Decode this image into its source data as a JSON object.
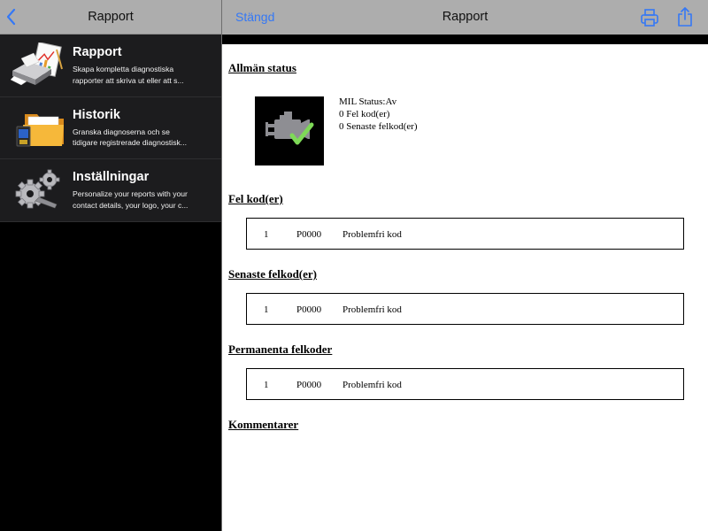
{
  "sidebar": {
    "title": "Rapport",
    "back_icon": "chevron-left-icon",
    "items": [
      {
        "title": "Rapport",
        "desc1": "Skapa kompletta diagnostiska",
        "desc2": "rapporter att skriva ut eller att s...",
        "icon": "report-printer-icon"
      },
      {
        "title": "Historik",
        "desc1": "Granska diagnoserna och se",
        "desc2": "tidigare registrerade diagnostisk...",
        "icon": "folder-history-icon"
      },
      {
        "title": "Inställningar",
        "desc1": "Personalize your reports with your",
        "desc2": "contact details, your logo, your c...",
        "icon": "gears-settings-icon"
      }
    ]
  },
  "header": {
    "close_label": "Stängd",
    "title": "Rapport",
    "print_icon": "printer-icon",
    "share_icon": "share-icon",
    "accent_color": "#3478f6"
  },
  "report": {
    "general_status": {
      "heading": "Allmän status",
      "icon": "engine-check-icon",
      "mil_status": "MIL Status:Av",
      "fault_count": "0 Fel kod(er)",
      "recent_count": "0 Senaste felkod(er)"
    },
    "fault_codes": {
      "heading": "Fel kod(er)",
      "rows": [
        {
          "num": "1",
          "code": "P0000",
          "desc": "Problemfri kod"
        }
      ]
    },
    "recent_codes": {
      "heading": "Senaste felkod(er)",
      "rows": [
        {
          "num": "1",
          "code": "P0000",
          "desc": "Problemfri kod"
        }
      ]
    },
    "permanent_codes": {
      "heading": "Permanenta felkoder",
      "rows": [
        {
          "num": "1",
          "code": "P0000",
          "desc": "Problemfri kod"
        }
      ]
    },
    "comments": {
      "heading": "Kommentarer"
    }
  }
}
